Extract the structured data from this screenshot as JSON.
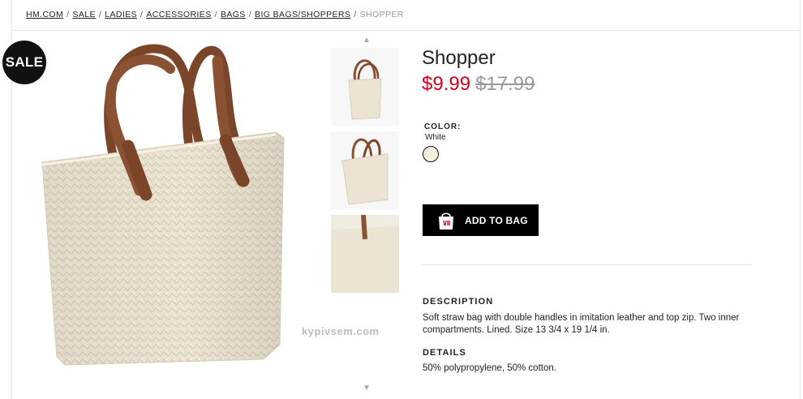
{
  "breadcrumb": {
    "items": [
      "HM.COM",
      "SALE",
      "LADIES",
      "ACCESSORIES",
      "BAGS",
      "BIG BAGS/SHOPPERS"
    ],
    "current": "SHOPPER",
    "separator": "/"
  },
  "badge": {
    "sale": "SALE"
  },
  "gallery": {
    "watermark": "kypivsem.com",
    "thumb_count": 3,
    "up_icon": "chevron-up-icon",
    "down_icon": "chevron-down-icon"
  },
  "product": {
    "title": "Shopper",
    "price_sale": "$9.99",
    "price_old": "$17.99",
    "color_label": "COLOR:",
    "color_value": "White",
    "swatch_color": "#f6efdf",
    "add_button": "ADD TO BAG",
    "description_title": "DESCRIPTION",
    "description_text": "Soft straw bag with double handles in imitation leather and top zip. Two inner compartments. Lined. Size 13 3/4 x 19 1/4 in.",
    "details_title": "DETAILS",
    "details_text": "50% polypropylene, 50% cotton."
  },
  "colors": {
    "sale_red": "#d6001c",
    "button_black": "#000000",
    "straw": "#ece4d2",
    "leather": "#8a5133"
  }
}
